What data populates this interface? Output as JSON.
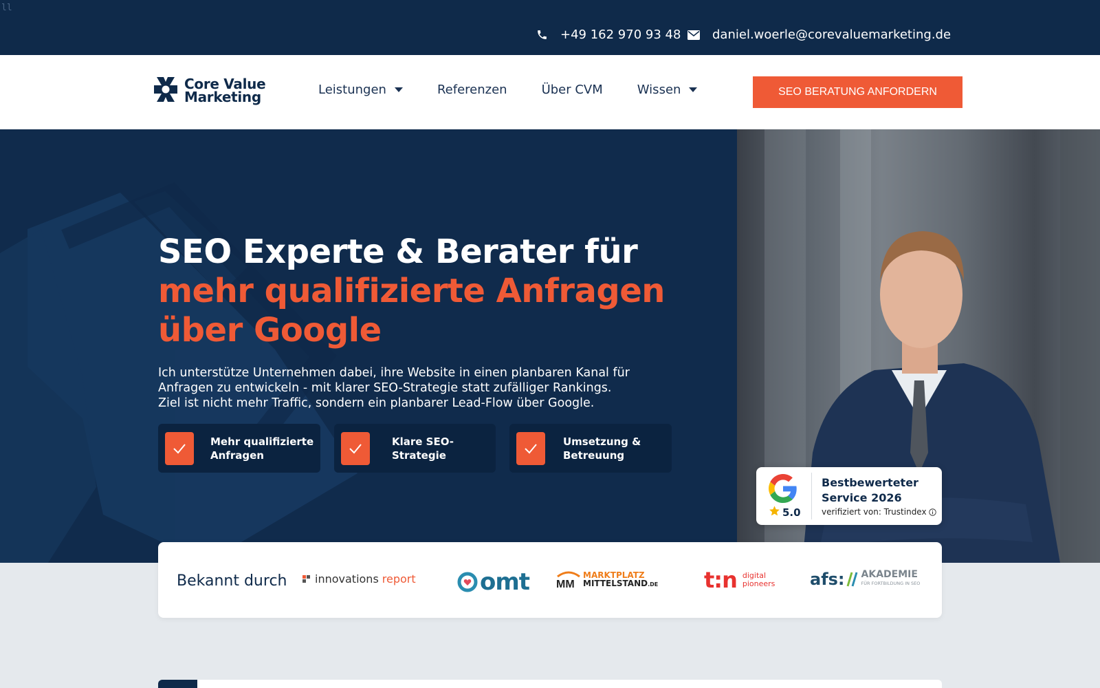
{
  "topbar": {
    "corner_text": "ll",
    "phone": "+49 162 970 93 48",
    "email": "daniel.woerle@corevaluemarketing.de"
  },
  "header": {
    "logo_line1": "Core Value",
    "logo_line2": "Marketing",
    "nav": [
      {
        "label": "Leistungen",
        "has_dropdown": true
      },
      {
        "label": "Referenzen",
        "has_dropdown": false
      },
      {
        "label": "Über CVM",
        "has_dropdown": false
      },
      {
        "label": "Wissen",
        "has_dropdown": true
      }
    ],
    "cta_label": "SEO BERATUNG ANFORDERN"
  },
  "hero": {
    "title_line1": "SEO Experte & Berater für",
    "title_line2": "mehr qualifizierte Anfragen",
    "title_line3": "über Google",
    "lead_line1": "Ich unterstütze Unternehmen dabei, ihre Website in einen planbaren Kanal für",
    "lead_line2": "Anfragen zu entwickeln - mit klarer SEO-Strategie statt zufälliger Rankings.",
    "lead_line3": "Ziel ist nicht mehr Traffic, sondern ein planbarer Lead-Flow über Google.",
    "features": [
      {
        "line1": "Mehr qualifizierte",
        "line2": "Anfragen"
      },
      {
        "line1": "Klare SEO-",
        "line2": "Strategie"
      },
      {
        "line1": "Umsetzung &",
        "line2": "Betreuung"
      }
    ]
  },
  "review": {
    "rating": "5.0",
    "title_line1": "Bestbewerteter",
    "title_line2": "Service 2026",
    "verified": "verifiziert von: Trustindex"
  },
  "known_by": {
    "title": "Bekannt durch",
    "logos": {
      "innovations_a": "innovations",
      "innovations_b": "report",
      "omt": "omt",
      "mm_line1": "MARKTPLATZ",
      "mm_line2": "MITTELSTAND",
      "mm_suffix": ".DE",
      "t3n_a": "t:n",
      "t3n_b1": "digital",
      "t3n_b2": "pioneers",
      "afs_a": "afs:",
      "afs_b": "AKADEMIE",
      "afs_c": "FÜR FORTBILDUNG IN SEO"
    }
  },
  "colors": {
    "navy": "#0f2a4a",
    "accent": "#ef5a36",
    "white": "#ffffff",
    "page_bg": "#e5e9ed"
  },
  "icons": [
    "phone-icon",
    "mail-icon",
    "logo-mark-icon",
    "chevron-down-icon",
    "check-icon",
    "google-icon",
    "star-icon",
    "info-icon"
  ]
}
